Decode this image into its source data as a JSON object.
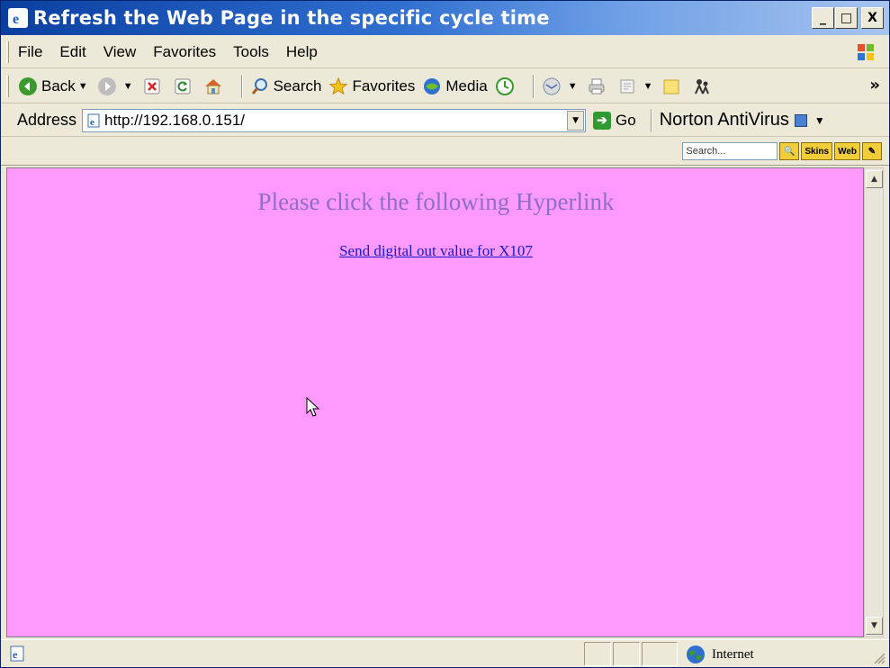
{
  "window": {
    "title": "Refresh the Web Page in the specific cycle time",
    "controls": {
      "minimize": "_",
      "maximize": "□",
      "close": "X"
    }
  },
  "menu": {
    "items": [
      "File",
      "Edit",
      "View",
      "Favorites",
      "Tools",
      "Help"
    ]
  },
  "toolbar": {
    "back_label": "Back",
    "search_label": "Search",
    "favorites_label": "Favorites",
    "media_label": "Media",
    "overflow": "»"
  },
  "address": {
    "label": "Address",
    "url": "http://192.168.0.151/",
    "go_label": "Go",
    "norton_label": "Norton AntiVirus"
  },
  "search_toolbar": {
    "placeholder": "Search...",
    "skins_label": "Skins",
    "web_label": "Web"
  },
  "page": {
    "background": "#ff99ff",
    "heading": "Please click the following Hyperlink",
    "link_text": "Send digital out value for X107"
  },
  "status": {
    "zone_label": "Internet"
  }
}
